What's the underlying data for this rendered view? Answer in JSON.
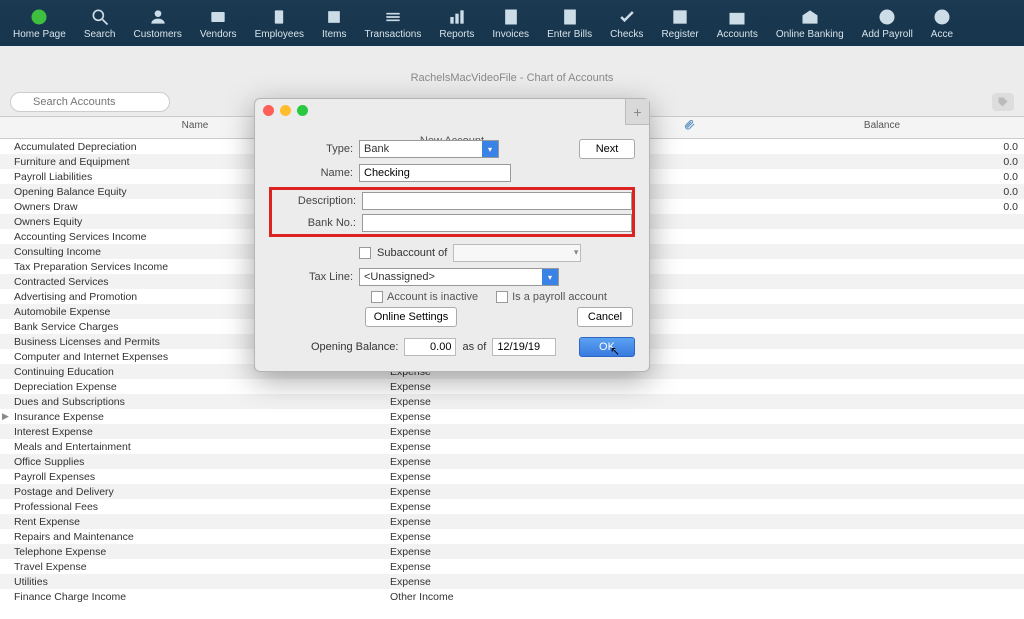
{
  "toolbar": [
    {
      "id": "home",
      "label": "Home Page"
    },
    {
      "id": "search",
      "label": "Search"
    },
    {
      "id": "customers",
      "label": "Customers"
    },
    {
      "id": "vendors",
      "label": "Vendors"
    },
    {
      "id": "employees",
      "label": "Employees"
    },
    {
      "id": "items",
      "label": "Items"
    },
    {
      "id": "transactions",
      "label": "Transactions"
    },
    {
      "id": "reports",
      "label": "Reports"
    },
    {
      "id": "invoices",
      "label": "Invoices"
    },
    {
      "id": "enterbills",
      "label": "Enter Bills"
    },
    {
      "id": "checks",
      "label": "Checks"
    },
    {
      "id": "register",
      "label": "Register"
    },
    {
      "id": "accounts",
      "label": "Accounts"
    },
    {
      "id": "onlinebanking",
      "label": "Online Banking"
    },
    {
      "id": "addpayroll",
      "label": "Add Payroll"
    },
    {
      "id": "acce",
      "label": "Acce"
    }
  ],
  "window_title": "RachelsMacVideoFile - Chart of Accounts",
  "search_placeholder": "Search Accounts",
  "columns": {
    "name": "Name",
    "type": "",
    "attach": "",
    "balance": "Balance"
  },
  "accounts": [
    {
      "name": "Accumulated Depreciation",
      "type": "",
      "balance": "0.0"
    },
    {
      "name": "Furniture and Equipment",
      "type": "",
      "balance": "0.0"
    },
    {
      "name": "Payroll Liabilities",
      "type": "",
      "balance": "0.0"
    },
    {
      "name": "Opening Balance Equity",
      "type": "",
      "balance": "0.0"
    },
    {
      "name": "Owners Draw",
      "type": "",
      "balance": "0.0"
    },
    {
      "name": "Owners Equity",
      "type": "",
      "balance": ""
    },
    {
      "name": "Accounting Services Income",
      "type": "",
      "balance": ""
    },
    {
      "name": "Consulting Income",
      "type": "",
      "balance": ""
    },
    {
      "name": "Tax Preparation Services Income",
      "type": "",
      "balance": ""
    },
    {
      "name": "Contracted Services",
      "type": "",
      "balance": ""
    },
    {
      "name": "Advertising and Promotion",
      "type": "",
      "balance": ""
    },
    {
      "name": "Automobile Expense",
      "type": "",
      "balance": ""
    },
    {
      "name": "Bank Service Charges",
      "type": "",
      "balance": ""
    },
    {
      "name": "Business Licenses and Permits",
      "type": "",
      "balance": ""
    },
    {
      "name": "Computer and Internet Expenses",
      "type": "",
      "balance": ""
    },
    {
      "name": "Continuing Education",
      "type": "Expense",
      "balance": ""
    },
    {
      "name": "Depreciation Expense",
      "type": "Expense",
      "balance": ""
    },
    {
      "name": "Dues and Subscriptions",
      "type": "Expense",
      "balance": ""
    },
    {
      "name": "Insurance Expense",
      "type": "Expense",
      "balance": "",
      "tri": true
    },
    {
      "name": "Interest Expense",
      "type": "Expense",
      "balance": ""
    },
    {
      "name": "Meals and Entertainment",
      "type": "Expense",
      "balance": ""
    },
    {
      "name": "Office Supplies",
      "type": "Expense",
      "balance": ""
    },
    {
      "name": "Payroll Expenses",
      "type": "Expense",
      "balance": ""
    },
    {
      "name": "Postage and Delivery",
      "type": "Expense",
      "balance": ""
    },
    {
      "name": "Professional Fees",
      "type": "Expense",
      "balance": ""
    },
    {
      "name": "Rent Expense",
      "type": "Expense",
      "balance": ""
    },
    {
      "name": "Repairs and Maintenance",
      "type": "Expense",
      "balance": ""
    },
    {
      "name": "Telephone Expense",
      "type": "Expense",
      "balance": ""
    },
    {
      "name": "Travel Expense",
      "type": "Expense",
      "balance": ""
    },
    {
      "name": "Utilities",
      "type": "Expense",
      "balance": ""
    },
    {
      "name": "Finance Charge Income",
      "type": "Other Income",
      "balance": ""
    }
  ],
  "modal": {
    "title": "New Account",
    "type_label": "Type:",
    "type_value": "Bank",
    "name_label": "Name:",
    "name_value": "Checking",
    "description_label": "Description:",
    "description_value": "",
    "bankno_label": "Bank No.:",
    "bankno_value": "",
    "subaccount_label": "Subaccount of",
    "taxline_label": "Tax Line:",
    "taxline_value": "<Unassigned>",
    "inactive_label": "Account is inactive",
    "payroll_label": "Is a payroll account",
    "online_settings": "Online Settings",
    "opening_balance_label": "Opening Balance:",
    "opening_balance_value": "0.00",
    "asof_label": "as of",
    "asof_value": "12/19/19",
    "next": "Next",
    "cancel": "Cancel",
    "ok": "OK"
  }
}
